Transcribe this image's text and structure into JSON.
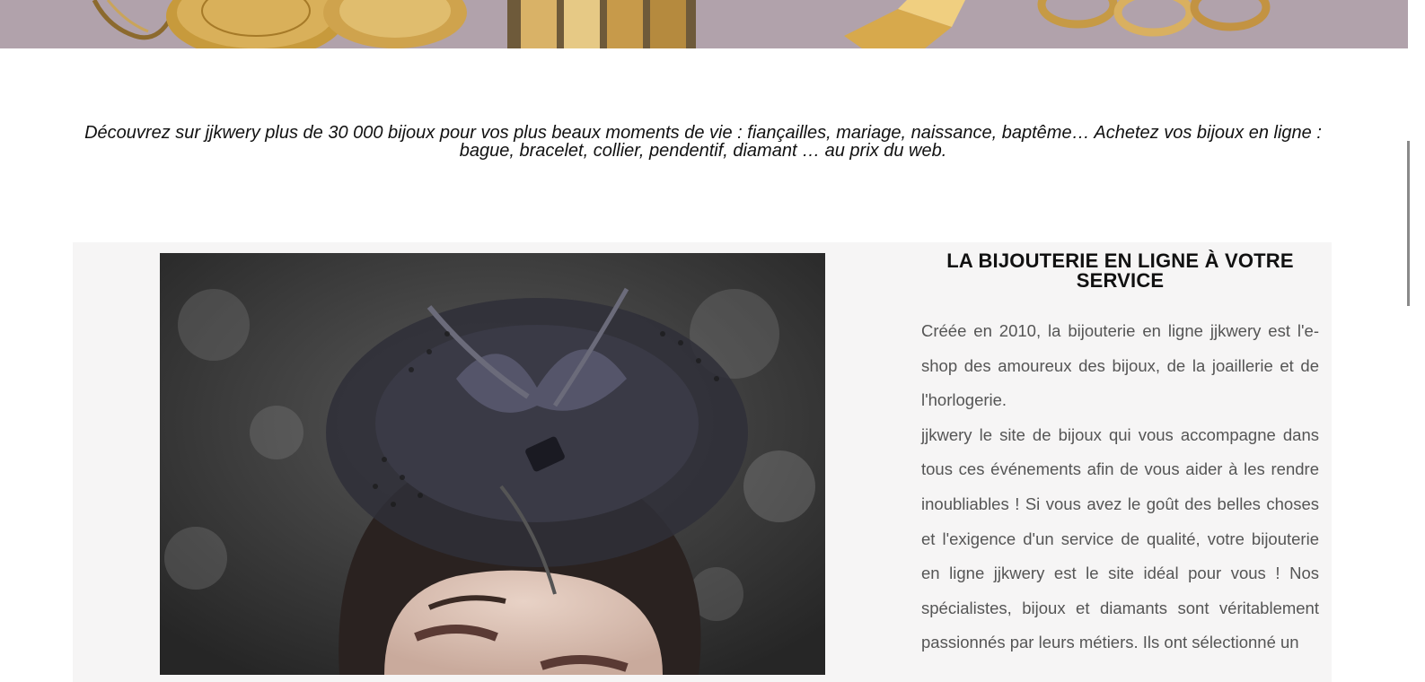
{
  "banner": {
    "image_alt": "",
    "icon": "jewelry-photo"
  },
  "intro": {
    "text": "Découvrez sur jjkwery plus de 30 000 bijoux pour vos plus beaux moments de vie : fiançailles, mariage, naissance, baptême… Achetez vos bijoux en ligne : bague, bracelet, collier, pendentif, diamant … au prix du web."
  },
  "service": {
    "title": "LA BIJOUTERIE EN LIGNE À VOTRE SERVICE",
    "paragraph1": "Créée en 2010, la bijouterie en ligne jjkwery est l'e-shop des amoureux des bijoux, de la joaillerie et de l'horlogerie.",
    "paragraph2": "jjkwery le site de bijoux qui vous accompagne dans tous ces événements afin de vous aider à les rendre inoubliables ! Si vous avez le goût des belles choses et l'exigence d'un service de qualité, votre bijouterie en ligne jjkwery est le site idéal pour vous ! Nos spécialistes, bijoux et diamants sont véritablement passionnés par leurs métiers. Ils ont sélectionné un",
    "photo_icon": "model-with-fascinator-photo"
  },
  "colors": {
    "panel_bg": "#f6f5f5",
    "text_dark": "#111111",
    "text_body": "#555555"
  }
}
